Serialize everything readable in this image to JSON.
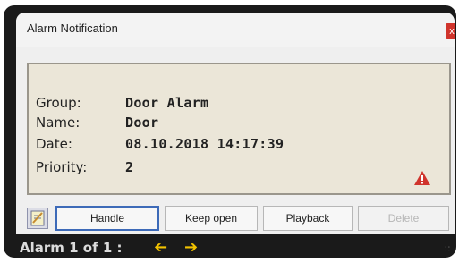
{
  "window": {
    "title": "Alarm Notification",
    "close_label": "x"
  },
  "details": [
    {
      "label": "Group:",
      "value": "Door Alarm"
    },
    {
      "label": "Name:",
      "value": "Door"
    },
    {
      "label": "Date:",
      "value": "08.10.2018 14:17:39"
    },
    {
      "label": "Priority:",
      "value": "2"
    }
  ],
  "buttons": {
    "handle": "Handle",
    "keep_open": "Keep open",
    "playback": "Playback",
    "delete": "Delete"
  },
  "status": {
    "text": "Alarm 1 of 1 :"
  },
  "colors": {
    "info_bg": "#ebe6d8",
    "warning": "#d0342c",
    "arrows": "#f2c200",
    "primary_border": "#3d6ab8"
  },
  "icons": [
    "warning-icon",
    "note-icon",
    "arrow-left-icon",
    "arrow-right-icon",
    "close-icon",
    "resize-grip-icon"
  ]
}
